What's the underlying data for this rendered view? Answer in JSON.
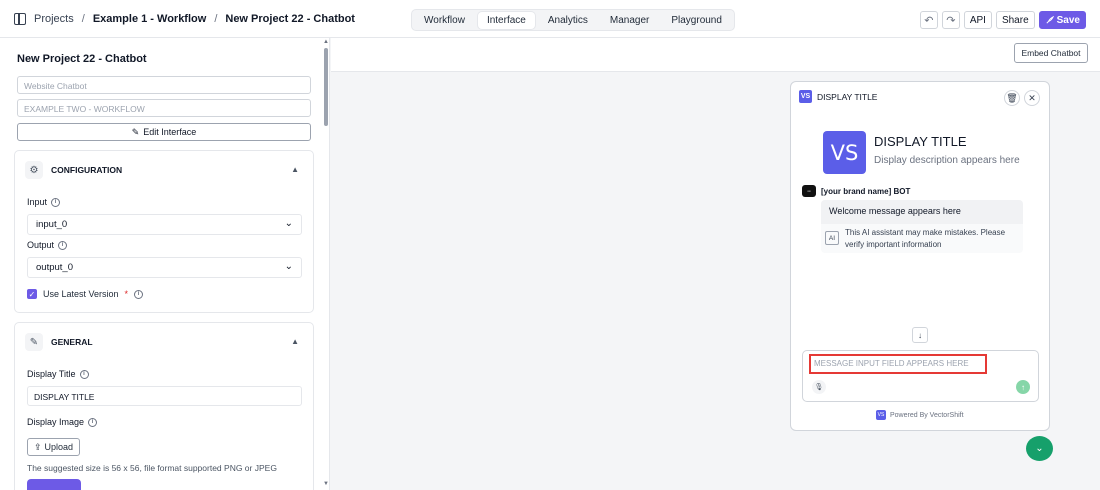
{
  "breadcrumb": {
    "items": [
      "Projects",
      "Example 1 - Workflow",
      "New Project 22 - Chatbot"
    ],
    "separator": "/"
  },
  "nav_tabs": [
    "Workflow",
    "Interface",
    "Analytics",
    "Manager",
    "Playground"
  ],
  "active_tab": "Interface",
  "toolbar": {
    "undo_icon": "↶",
    "redo_icon": "↷",
    "api_label": "API",
    "share_label": "Share",
    "save_label": "Save"
  },
  "left_panel": {
    "title": "New Project 22 - Chatbot",
    "name_placeholder": "Website Chatbot",
    "workflow_placeholder": "EXAMPLE TWO - WORKFLOW",
    "edit_button": "Edit Interface",
    "configuration": {
      "title": "CONFIGURATION",
      "input_label": "Input",
      "input_value": "input_0",
      "output_label": "Output",
      "output_value": "output_0",
      "latest_version_label": "Use Latest Version",
      "latest_version_checked": true,
      "required_mark": "*"
    },
    "general": {
      "title": "GENERAL",
      "display_title_label": "Display Title",
      "display_title_value": "DISPLAY TITLE",
      "display_image_label": "Display Image",
      "upload_label": "Upload",
      "size_hint": "The suggested size is 56 x 56, file format supported PNG or JPEG"
    }
  },
  "main": {
    "embed_button": "Embed Chatbot"
  },
  "chat": {
    "header_title": "DISPLAY TITLE",
    "logo_text": "VS",
    "display_title": "DISPLAY TITLE",
    "display_description": "Display description appears here",
    "bot_name": "[your brand name] BOT",
    "welcome_message": "Welcome message appears here",
    "ai_badge": "AI",
    "disclaimer": "This AI assistant may make mistakes. Please verify important information",
    "input_placeholder": "MESSAGE INPUT FIELD APPEARS HERE",
    "powered_by": "Powered By VectorShift"
  },
  "colors": {
    "accent": "#6d5ae6",
    "logo": "#5b5ee8",
    "fab": "#16a06b",
    "highlight": "#e53935"
  }
}
